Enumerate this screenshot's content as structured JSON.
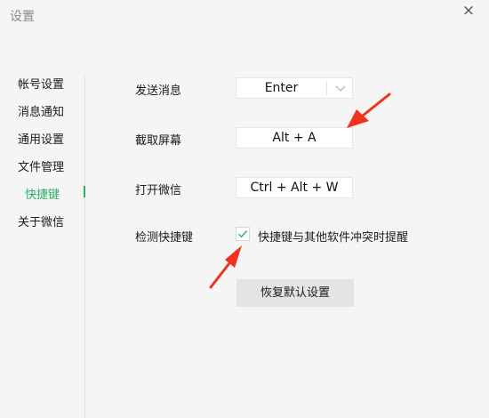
{
  "window": {
    "title": "设置",
    "close_glyph": "×"
  },
  "sidebar": {
    "items": [
      {
        "label": "帐号设置"
      },
      {
        "label": "消息通知"
      },
      {
        "label": "通用设置"
      },
      {
        "label": "文件管理"
      },
      {
        "label": "快捷键",
        "active": true
      },
      {
        "label": "关于微信"
      }
    ],
    "accent_color": "#2aae67"
  },
  "shortcuts": {
    "send_message": {
      "label": "发送消息",
      "value": "Enter"
    },
    "screenshot": {
      "label": "截取屏幕",
      "value": "Alt + A"
    },
    "open_wechat": {
      "label": "打开微信",
      "value": "Ctrl + Alt + W"
    },
    "detect": {
      "label": "检测快捷键",
      "checkbox_label": "快捷键与其他软件冲突时提醒",
      "checked": true
    },
    "restore_button": "恢复默认设置"
  },
  "annotations": {
    "arrow_color": "#f0321e"
  },
  "icons": {
    "close": "close-icon",
    "dropdown": "chevron-down-icon",
    "check": "check-icon",
    "arrow": "red-arrow-icon"
  }
}
